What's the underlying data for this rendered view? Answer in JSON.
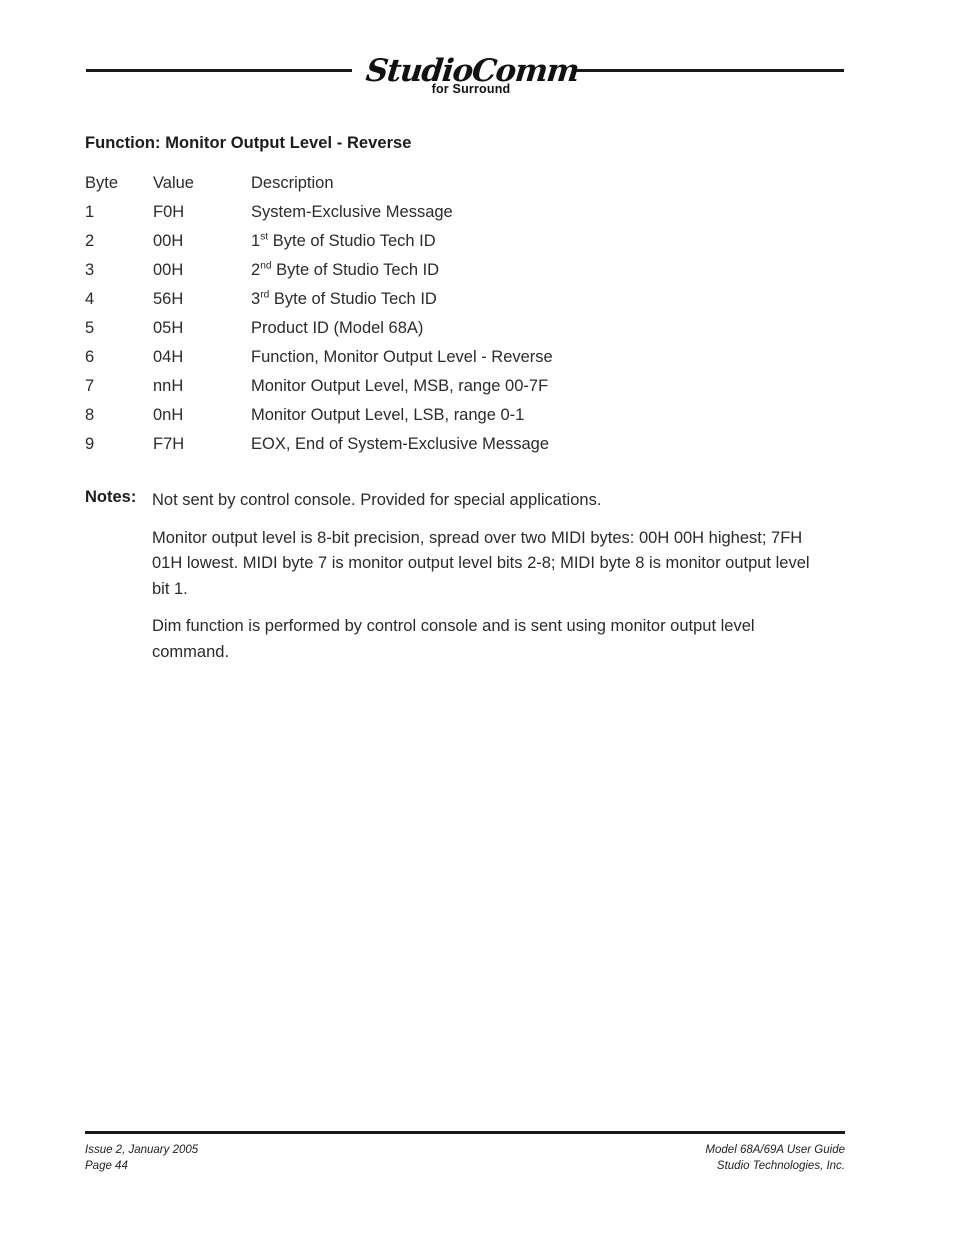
{
  "header": {
    "logo_name": "StudioComm",
    "logo_tagline": "for Surround"
  },
  "main": {
    "section_title": "Function: Monitor Output Level - Reverse",
    "table": {
      "headers": {
        "byte": "Byte",
        "value": "Value",
        "description": "Description"
      },
      "rows": [
        {
          "byte": "1",
          "value": "F0H",
          "desc_pre": "",
          "ordinal": "",
          "ordinal_sup": "",
          "desc": "System-Exclusive Message"
        },
        {
          "byte": "2",
          "value": "00H",
          "desc_pre": "1",
          "ordinal": "",
          "ordinal_sup": "st",
          "desc": " Byte of Studio Tech ID"
        },
        {
          "byte": "3",
          "value": "00H",
          "desc_pre": "2",
          "ordinal": "",
          "ordinal_sup": "nd",
          "desc": " Byte of Studio Tech ID"
        },
        {
          "byte": "4",
          "value": "56H",
          "desc_pre": "3",
          "ordinal": "",
          "ordinal_sup": "rd",
          "desc": " Byte of Studio Tech ID"
        },
        {
          "byte": "5",
          "value": "05H",
          "desc_pre": "",
          "ordinal": "",
          "ordinal_sup": "",
          "desc": "Product ID (Model 68A)"
        },
        {
          "byte": "6",
          "value": "04H",
          "desc_pre": "",
          "ordinal": "",
          "ordinal_sup": "",
          "desc": "Function, Monitor Output Level - Reverse"
        },
        {
          "byte": "7",
          "value": "nnH",
          "desc_pre": "",
          "ordinal": "",
          "ordinal_sup": "",
          "desc": "Monitor Output Level, MSB, range 00-7F"
        },
        {
          "byte": "8",
          "value": "0nH",
          "desc_pre": "",
          "ordinal": "",
          "ordinal_sup": "",
          "desc": "Monitor Output Level, LSB, range 0-1"
        },
        {
          "byte": "9",
          "value": "F7H",
          "desc_pre": "",
          "ordinal": "",
          "ordinal_sup": "",
          "desc": "EOX, End of System-Exclusive Message"
        }
      ]
    },
    "notes": {
      "label": "Notes:",
      "paragraphs": [
        "Not sent by control console. Provided for special applications.",
        "Monitor output level is 8-bit precision, spread over two MIDI bytes: 00H 00H highest; 7FH 01H lowest. MIDI byte 7 is monitor output level bits 2-8; MIDI byte 8 is monitor output level bit 1.",
        "Dim function is performed by control console and is sent using monitor output level command."
      ]
    }
  },
  "footer": {
    "left_line1": "Issue 2, January 2005",
    "left_line2": "Page 44",
    "right_line1": "Model 68A/69A User Guide",
    "right_line2": "Studio Technologies, Inc."
  }
}
